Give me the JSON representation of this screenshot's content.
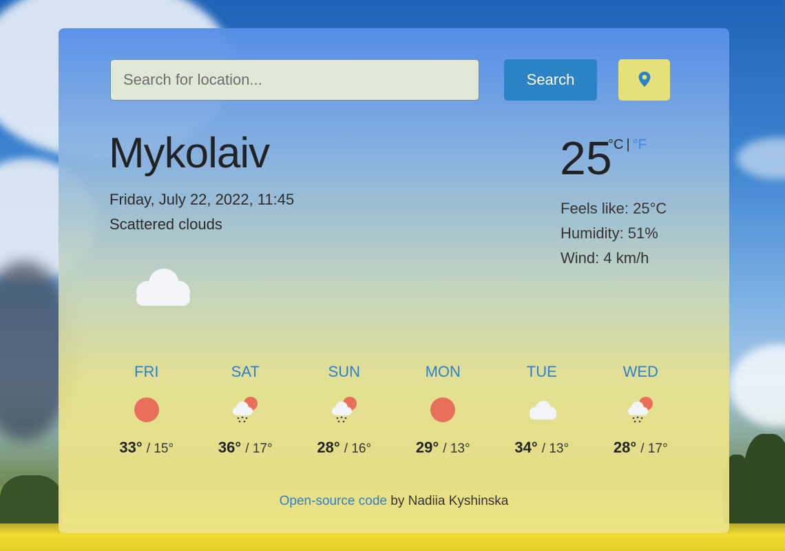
{
  "search": {
    "placeholder": "Search for location...",
    "button_label": "Search"
  },
  "location_button": {
    "icon": "location-pin-icon"
  },
  "current": {
    "city": "Mykolaiv",
    "datetime": "Friday, July 22, 2022, 11:45",
    "description": "Scattered clouds",
    "icon": "cloud-icon",
    "temperature": "25",
    "unit_c": "°C",
    "unit_sep": "|",
    "unit_f": "°F",
    "feels_like": "Feels like: 25°C",
    "humidity": "Humidity: 51%",
    "wind": "Wind: 4 km/h"
  },
  "forecast": [
    {
      "day": "FRI",
      "max": "33°",
      "min": "15°",
      "icon": "sun-icon"
    },
    {
      "day": "SAT",
      "max": "36°",
      "min": "17°",
      "icon": "rain-sun-cloud-icon"
    },
    {
      "day": "SUN",
      "max": "28°",
      "min": "16°",
      "icon": "rain-sun-cloud-icon"
    },
    {
      "day": "MON",
      "max": "29°",
      "min": "13°",
      "icon": "sun-icon"
    },
    {
      "day": "TUE",
      "max": "34°",
      "min": "13°",
      "icon": "cloud-icon"
    },
    {
      "day": "WED",
      "max": "28°",
      "min": "17°",
      "icon": "rain-sun-cloud-icon"
    }
  ],
  "footer": {
    "link_text": "Open-source code",
    "suffix": " by Nadiia Kyshinska"
  },
  "colors": {
    "accent": "#2b83c6",
    "link": "#2f7fcc",
    "sun": "#e8705a",
    "location_button_bg": "#e4e07a"
  }
}
